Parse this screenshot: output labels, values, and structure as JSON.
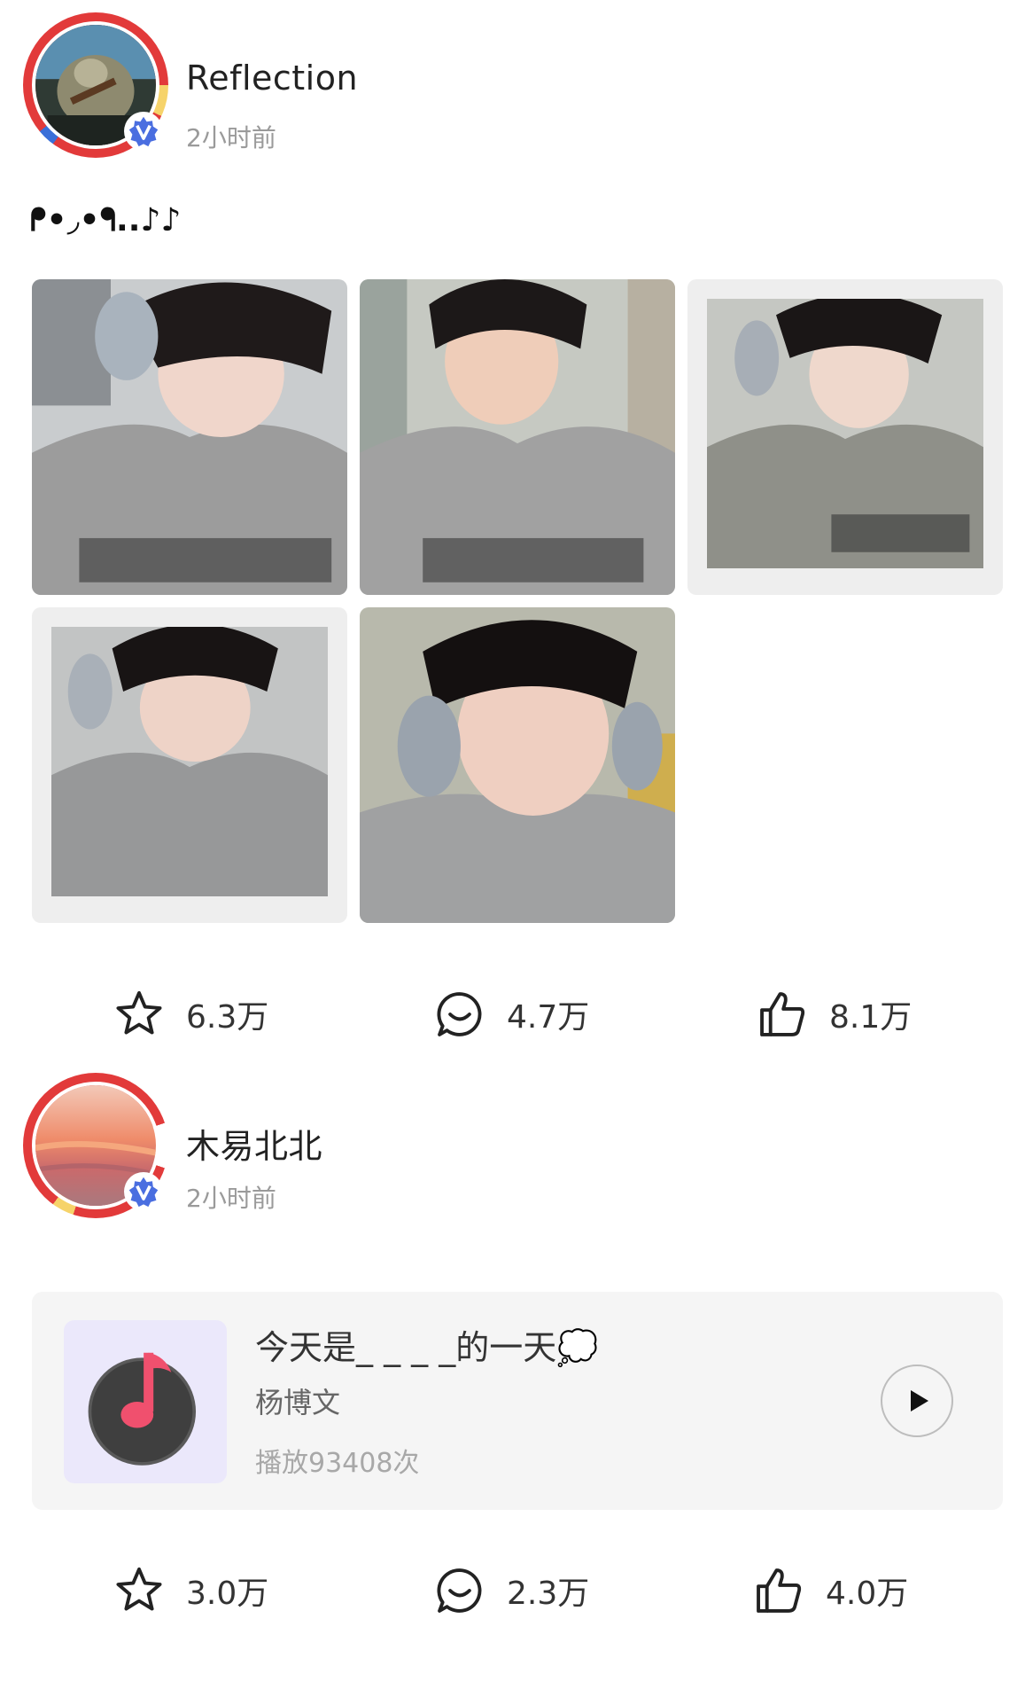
{
  "posts": [
    {
      "author": "Reflection",
      "time": "2小时前",
      "text": "ᖰ•◞•ᖳ..♪♪",
      "image_count": 5,
      "actions": {
        "favorites": "6.3万",
        "comments": "4.7万",
        "likes": "8.1万"
      }
    },
    {
      "author": "木易北北",
      "time": "2小时前",
      "music": {
        "title": "今天是_ _ _ _的一天💭",
        "artist": "杨博文",
        "plays": "播放93408次",
        "cover_icon": "music-note-icon"
      },
      "actions": {
        "favorites": "3.0万",
        "comments": "2.3万",
        "likes": "4.0万"
      }
    }
  ],
  "icons": {
    "favorite": "star-outline-icon",
    "comment": "comment-bubble-icon",
    "like": "thumbs-up-icon",
    "verified": "verified-badge-icon",
    "play": "play-icon"
  },
  "colors": {
    "verified": "#4a6ee0",
    "music_note": "#f0506e",
    "text_primary": "#222222",
    "text_secondary": "#9a9a9a"
  }
}
